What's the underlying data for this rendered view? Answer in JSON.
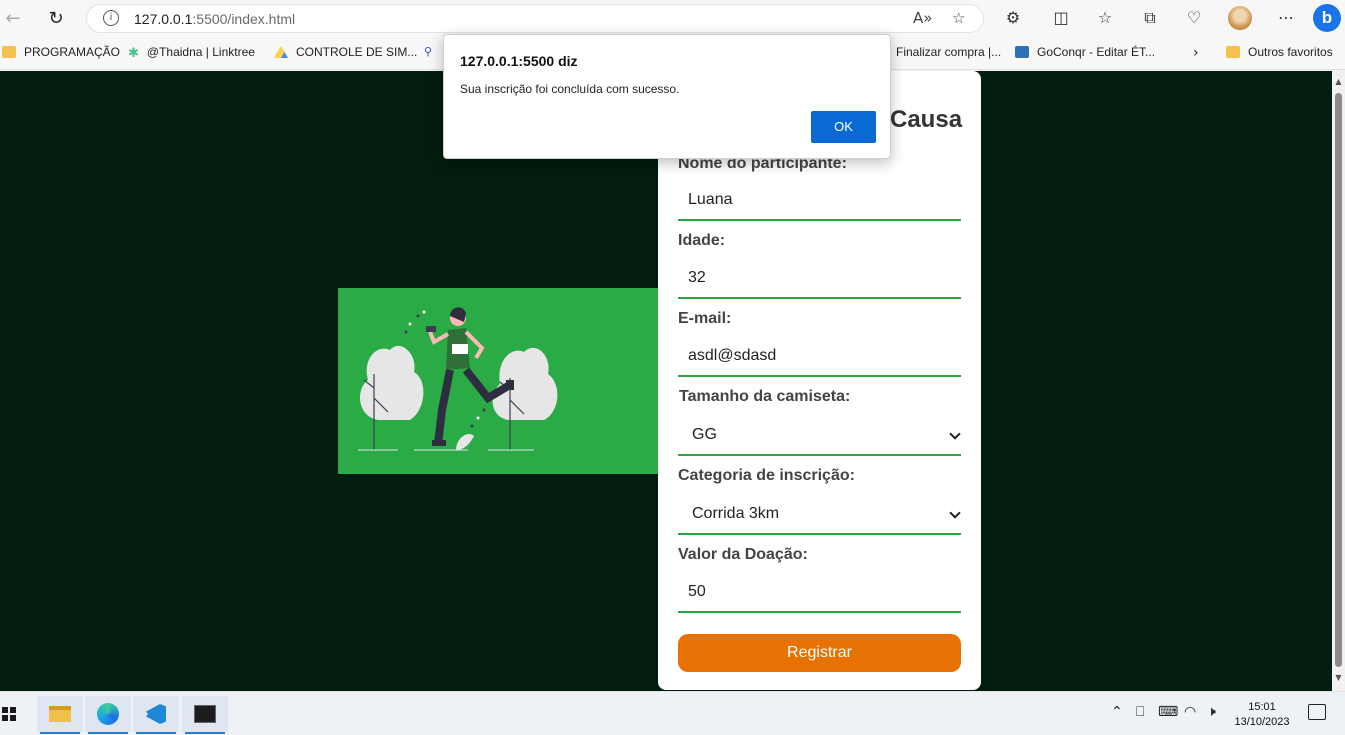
{
  "browser": {
    "url_host": "127.0.0.1",
    "url_path": ":5500/index.html",
    "bookmarks": [
      {
        "label": "PROGRAMAÇÃO",
        "icon": "folder-icon"
      },
      {
        "label": "@Thaidna | Linktree",
        "icon": "linktree-icon"
      },
      {
        "label": "CONTROLE DE SIM...",
        "icon": "google-drive-icon"
      },
      {
        "label": "Finalizar compra |...",
        "icon": "page-icon"
      },
      {
        "label": "GoConqr - Editar ÉT...",
        "icon": "goconqr-icon"
      },
      {
        "label": "Outros favoritos",
        "icon": "folder-icon"
      }
    ]
  },
  "form": {
    "title_visible": "Causa",
    "fields": [
      {
        "label": "Nome do participante:",
        "value": "Luana"
      },
      {
        "label": "Idade:",
        "value": "32"
      },
      {
        "label": "E-mail:",
        "value": "asdl@sdasd"
      },
      {
        "label": "Tamanho da camiseta:",
        "value": "GG"
      },
      {
        "label": "Categoria de inscrição:",
        "value": "Corrida 3km"
      },
      {
        "label": "Valor da Doação:",
        "value": "50"
      }
    ],
    "submit_label": "Registrar"
  },
  "dialog": {
    "title": "127.0.0.1:5500 diz",
    "message": "Sua inscrição foi concluída com sucesso.",
    "ok_label": "OK"
  },
  "taskbar": {
    "time": "15:01",
    "date": "13/10/2023"
  },
  "colors": {
    "page_background": "#021c0d",
    "accent_green": "#2aab45",
    "button_orange": "#e87104",
    "dialog_button": "#0a6ad3"
  }
}
